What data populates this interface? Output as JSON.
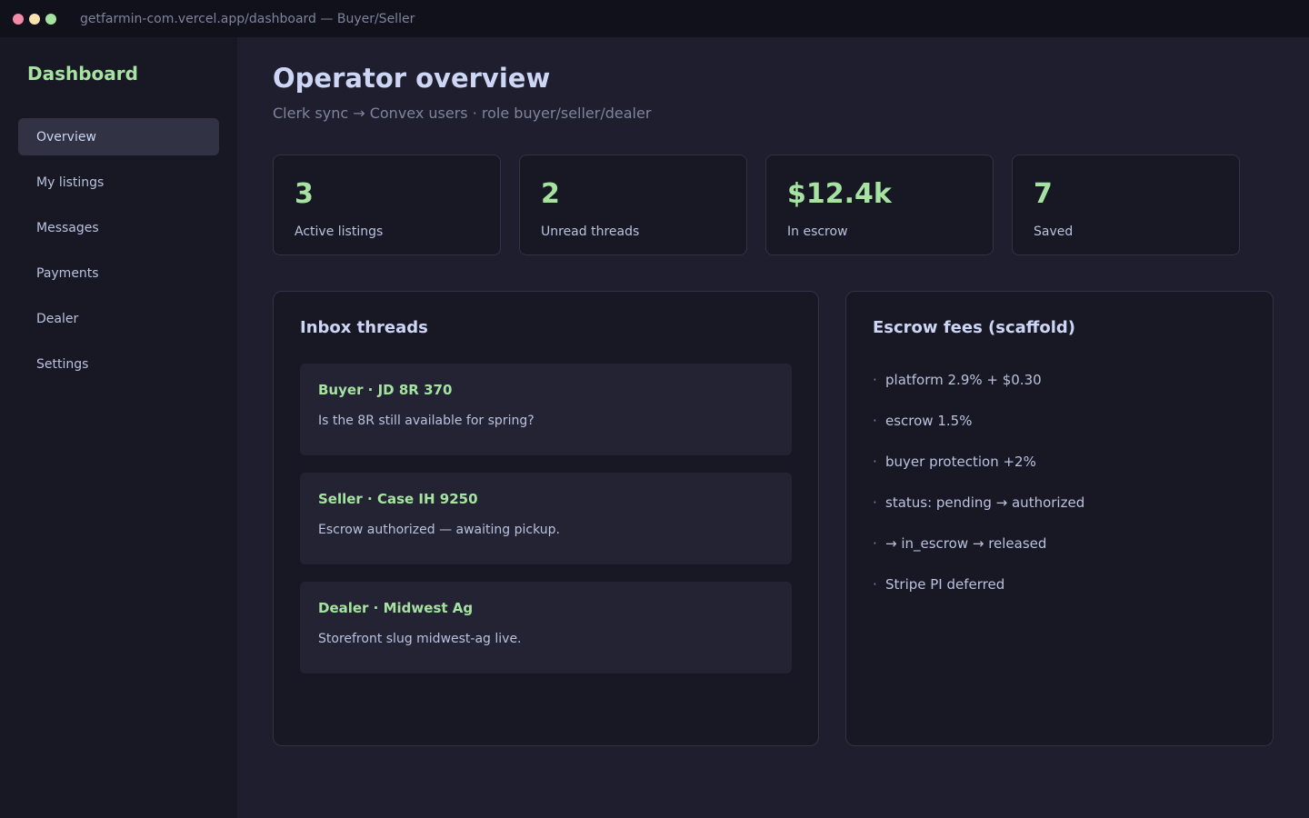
{
  "window": {
    "url": "getfarmin-com.vercel.app/dashboard — Buyer/Seller"
  },
  "sidebar": {
    "brand": "Dashboard",
    "items": [
      {
        "label": "Overview",
        "active": true
      },
      {
        "label": "My listings",
        "active": false
      },
      {
        "label": "Messages",
        "active": false
      },
      {
        "label": "Payments",
        "active": false
      },
      {
        "label": "Dealer",
        "active": false
      },
      {
        "label": "Settings",
        "active": false
      }
    ]
  },
  "header": {
    "title": "Operator overview",
    "subtitle": "Clerk sync → Convex users · role buyer/seller/dealer"
  },
  "stats": [
    {
      "value": "3",
      "label": "Active listings"
    },
    {
      "value": "2",
      "label": "Unread threads"
    },
    {
      "value": "$12.4k",
      "label": "In escrow"
    },
    {
      "value": "7",
      "label": "Saved"
    }
  ],
  "inbox": {
    "title": "Inbox threads",
    "threads": [
      {
        "title": "Buyer · JD 8R 370",
        "body": "Is the 8R still available for spring?"
      },
      {
        "title": "Seller · Case IH 9250",
        "body": "Escrow authorized — awaiting pickup."
      },
      {
        "title": "Dealer · Midwest Ag",
        "body": "Storefront slug midwest-ag live."
      }
    ]
  },
  "fees": {
    "title": "Escrow fees (scaffold)",
    "bullet": "·",
    "items": [
      "platform 2.9% + $0.30",
      "escrow 1.5%",
      "buyer protection +2%",
      "status: pending → authorized",
      "→ in_escrow → released",
      "Stripe PI deferred"
    ]
  },
  "colors": {
    "accent": "#a6e3a1",
    "background": "#1e1e2e",
    "sidebar": "#181825",
    "titlebar": "#11111b"
  }
}
